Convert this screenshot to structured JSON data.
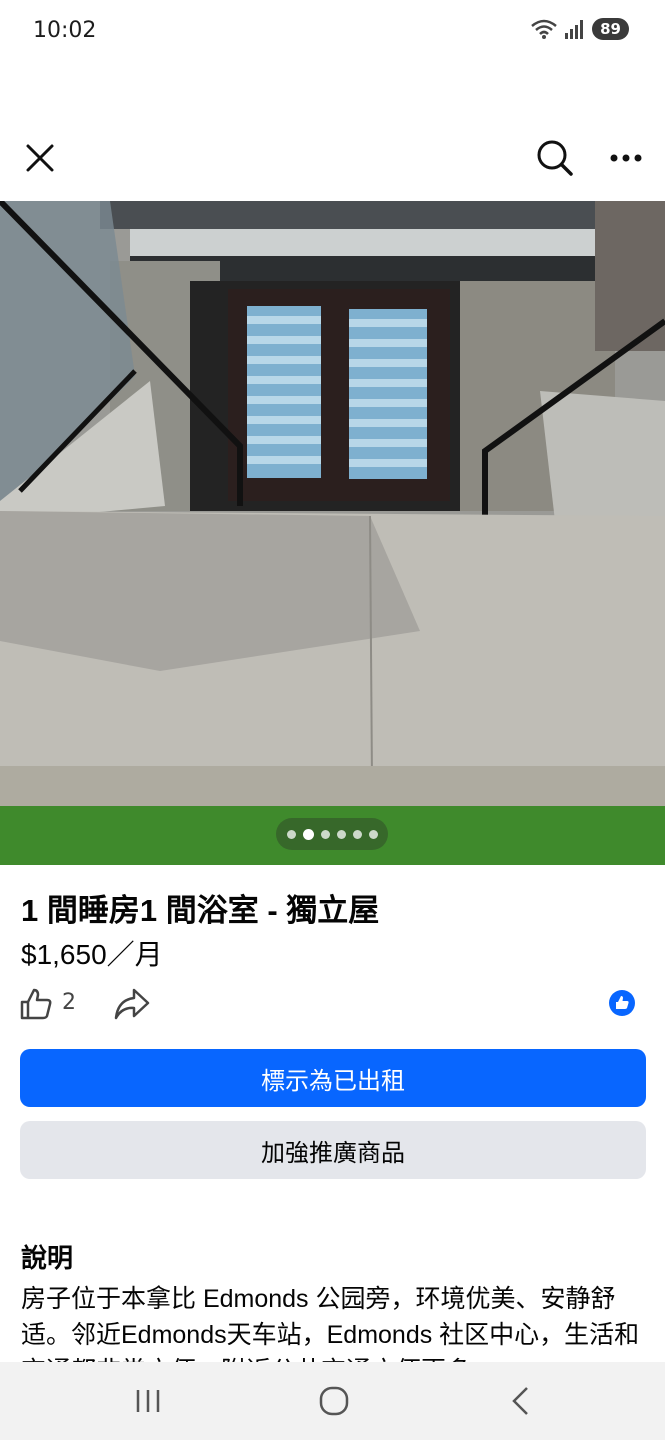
{
  "status_bar": {
    "time": "10:02",
    "battery": "89",
    "icons": [
      "wifi-icon",
      "signal-icon",
      "battery-icon"
    ]
  },
  "top_bar": {
    "icons": [
      "close-icon",
      "search-icon",
      "more-icon"
    ]
  },
  "carousel": {
    "photo_count": 6,
    "active_index": 1
  },
  "listing": {
    "title": "1 間睡房1 間浴室 - 獨立屋",
    "price": "$1,650／月",
    "like_count": "2"
  },
  "buttons": {
    "primary": "標示為已出租",
    "secondary": "加強推廣商品"
  },
  "description": {
    "heading": "說明",
    "text": "房子位于本拿比 Edmonds 公园旁，环境优美、安静舒适。邻近Edmonds天车站，Edmonds 社区中心，生活和交通都非常方便，附近公共交通方便更多"
  },
  "colors": {
    "accent": "#0866ff",
    "secondary_button": "#e4e6eb",
    "nav_bar": "#f2f2f2"
  },
  "nav_bar": {
    "icons": [
      "recents-icon",
      "home-icon",
      "back-icon"
    ]
  }
}
